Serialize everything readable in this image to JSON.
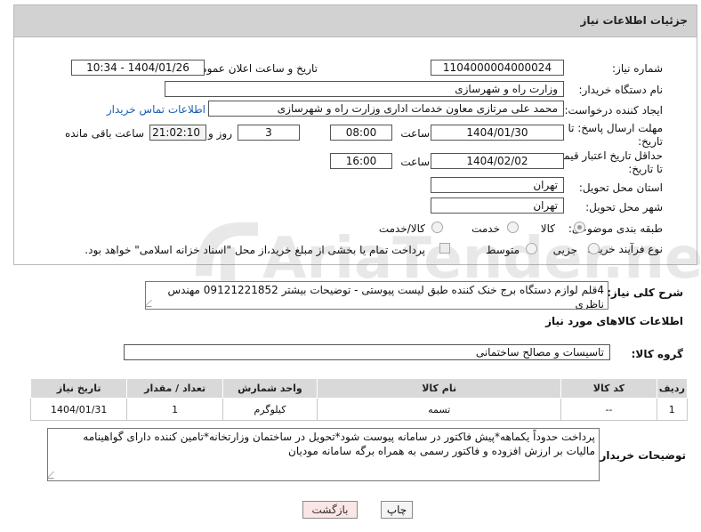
{
  "header": {
    "title": "جزئیات اطلاعات نیاز"
  },
  "fields": {
    "need_number_label": "شماره نیاز:",
    "need_number": "1104000004000024",
    "announce_label": "تاریخ و ساعت اعلان عمومی:",
    "announce_value": "1404/01/26 - 10:34",
    "buyer_org_label": "نام دستگاه خریدار:",
    "buyer_org": "وزارت راه و شهرسازی",
    "requester_label": "ایجاد کننده درخواست:",
    "requester": "محمد علی  مرتازی معاون خدمات اداری وزارت راه و شهرسازی",
    "buyer_contact_link": "اطلاعات تماس خریدار",
    "reply_deadline_label": "مهلت ارسال پاسخ: تا تاریخ:",
    "reply_date": "1404/01/30",
    "hour_label": "ساعت",
    "reply_time": "08:00",
    "days_value": "3",
    "days_label": "روز و",
    "remaining_time": "21:02:10",
    "remaining_label": "ساعت باقی مانده",
    "price_validity_label": "حداقل تاریخ اعتبار قیمت: تا تاریخ:",
    "price_date": "1404/02/02",
    "price_time": "16:00",
    "province_label": "استان محل تحویل:",
    "province": "تهران",
    "city_label": "شهر محل تحویل:",
    "city": "تهران",
    "category_label": "طبقه بندی موضوعی:",
    "category_options": [
      "کالا",
      "خدمت",
      "کالا/خدمت"
    ],
    "process_label": "نوع فرآیند خرید :",
    "process_options": [
      "جزیی",
      "متوسط"
    ],
    "payment_note": "پرداخت تمام یا بخشی از مبلغ خرید،از محل \"اسناد خزانه اسلامی\" خواهد بود."
  },
  "watermark": {
    "text": "AriaTender.neT"
  },
  "description": {
    "label": "شرح کلی نیاز:",
    "value": "4قلم لوازم دستگاه برج خنک کننده طبق لیست پیوستی - توضیحات بیشتر 09121221852 مهندس ناظری"
  },
  "goods": {
    "section_title": "اطلاعات کالاهای مورد نیاز",
    "group_label": "گروه کالا:",
    "group_value": "تاسیسات و مصالح ساختمانی",
    "columns": [
      "ردیف",
      "کد کالا",
      "نام کالا",
      "واحد شمارش",
      "تعداد / مقدار",
      "تاریخ نیاز"
    ],
    "rows": [
      [
        "1",
        "--",
        "تسمه",
        "کیلوگرم",
        "1",
        "1404/01/31"
      ]
    ]
  },
  "buyer_notes": {
    "label": "توضیحات خریدار:",
    "value": "پرداخت حدوداً یکماهه*پیش فاکتور در سامانه پیوست شود*تحویل در ساختمان وزارتخانه*تامین کننده دارای گواهینامه مالیات بر ارزش افزوده و فاکتور رسمی به همراه برگه  سامانه مودیان"
  },
  "buttons": {
    "print": "چاپ",
    "back": "بازگشت"
  }
}
